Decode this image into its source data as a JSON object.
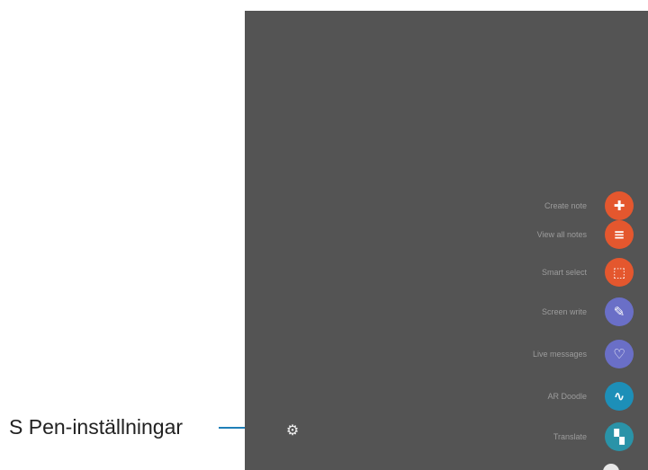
{
  "callout": {
    "label": "S Pen-inställningar"
  },
  "colors": {
    "screen_bg": "#545454",
    "callout_line": "#1f7fb8",
    "icon_orange": "#e4572e",
    "icon_purple": "#6a6fc7",
    "icon_teal": "#1d8fb8"
  },
  "air_command": {
    "settings_icon": "gear-icon",
    "items": [
      {
        "label": "Create note",
        "icon": "note-plus-icon",
        "color": "#e4572e",
        "glyph": "✚"
      },
      {
        "label": "View all notes",
        "icon": "notes-list-icon",
        "color": "#e4572e",
        "glyph": "≡"
      },
      {
        "label": "Smart select",
        "icon": "smart-select-icon",
        "color": "#e4572e",
        "glyph": "⬚"
      },
      {
        "label": "Screen write",
        "icon": "screen-write-icon",
        "color": "#6a6fc7",
        "glyph": "✎"
      },
      {
        "label": "Live messages",
        "icon": "heart-icon",
        "color": "#6a6fc7",
        "glyph": "♡"
      },
      {
        "label": "AR Doodle",
        "icon": "doodle-icon",
        "color": "#1d8fb8",
        "glyph": "∿"
      },
      {
        "label": "Translate",
        "icon": "translate-icon",
        "color": "#2a93a8",
        "glyph": "▚"
      }
    ]
  }
}
